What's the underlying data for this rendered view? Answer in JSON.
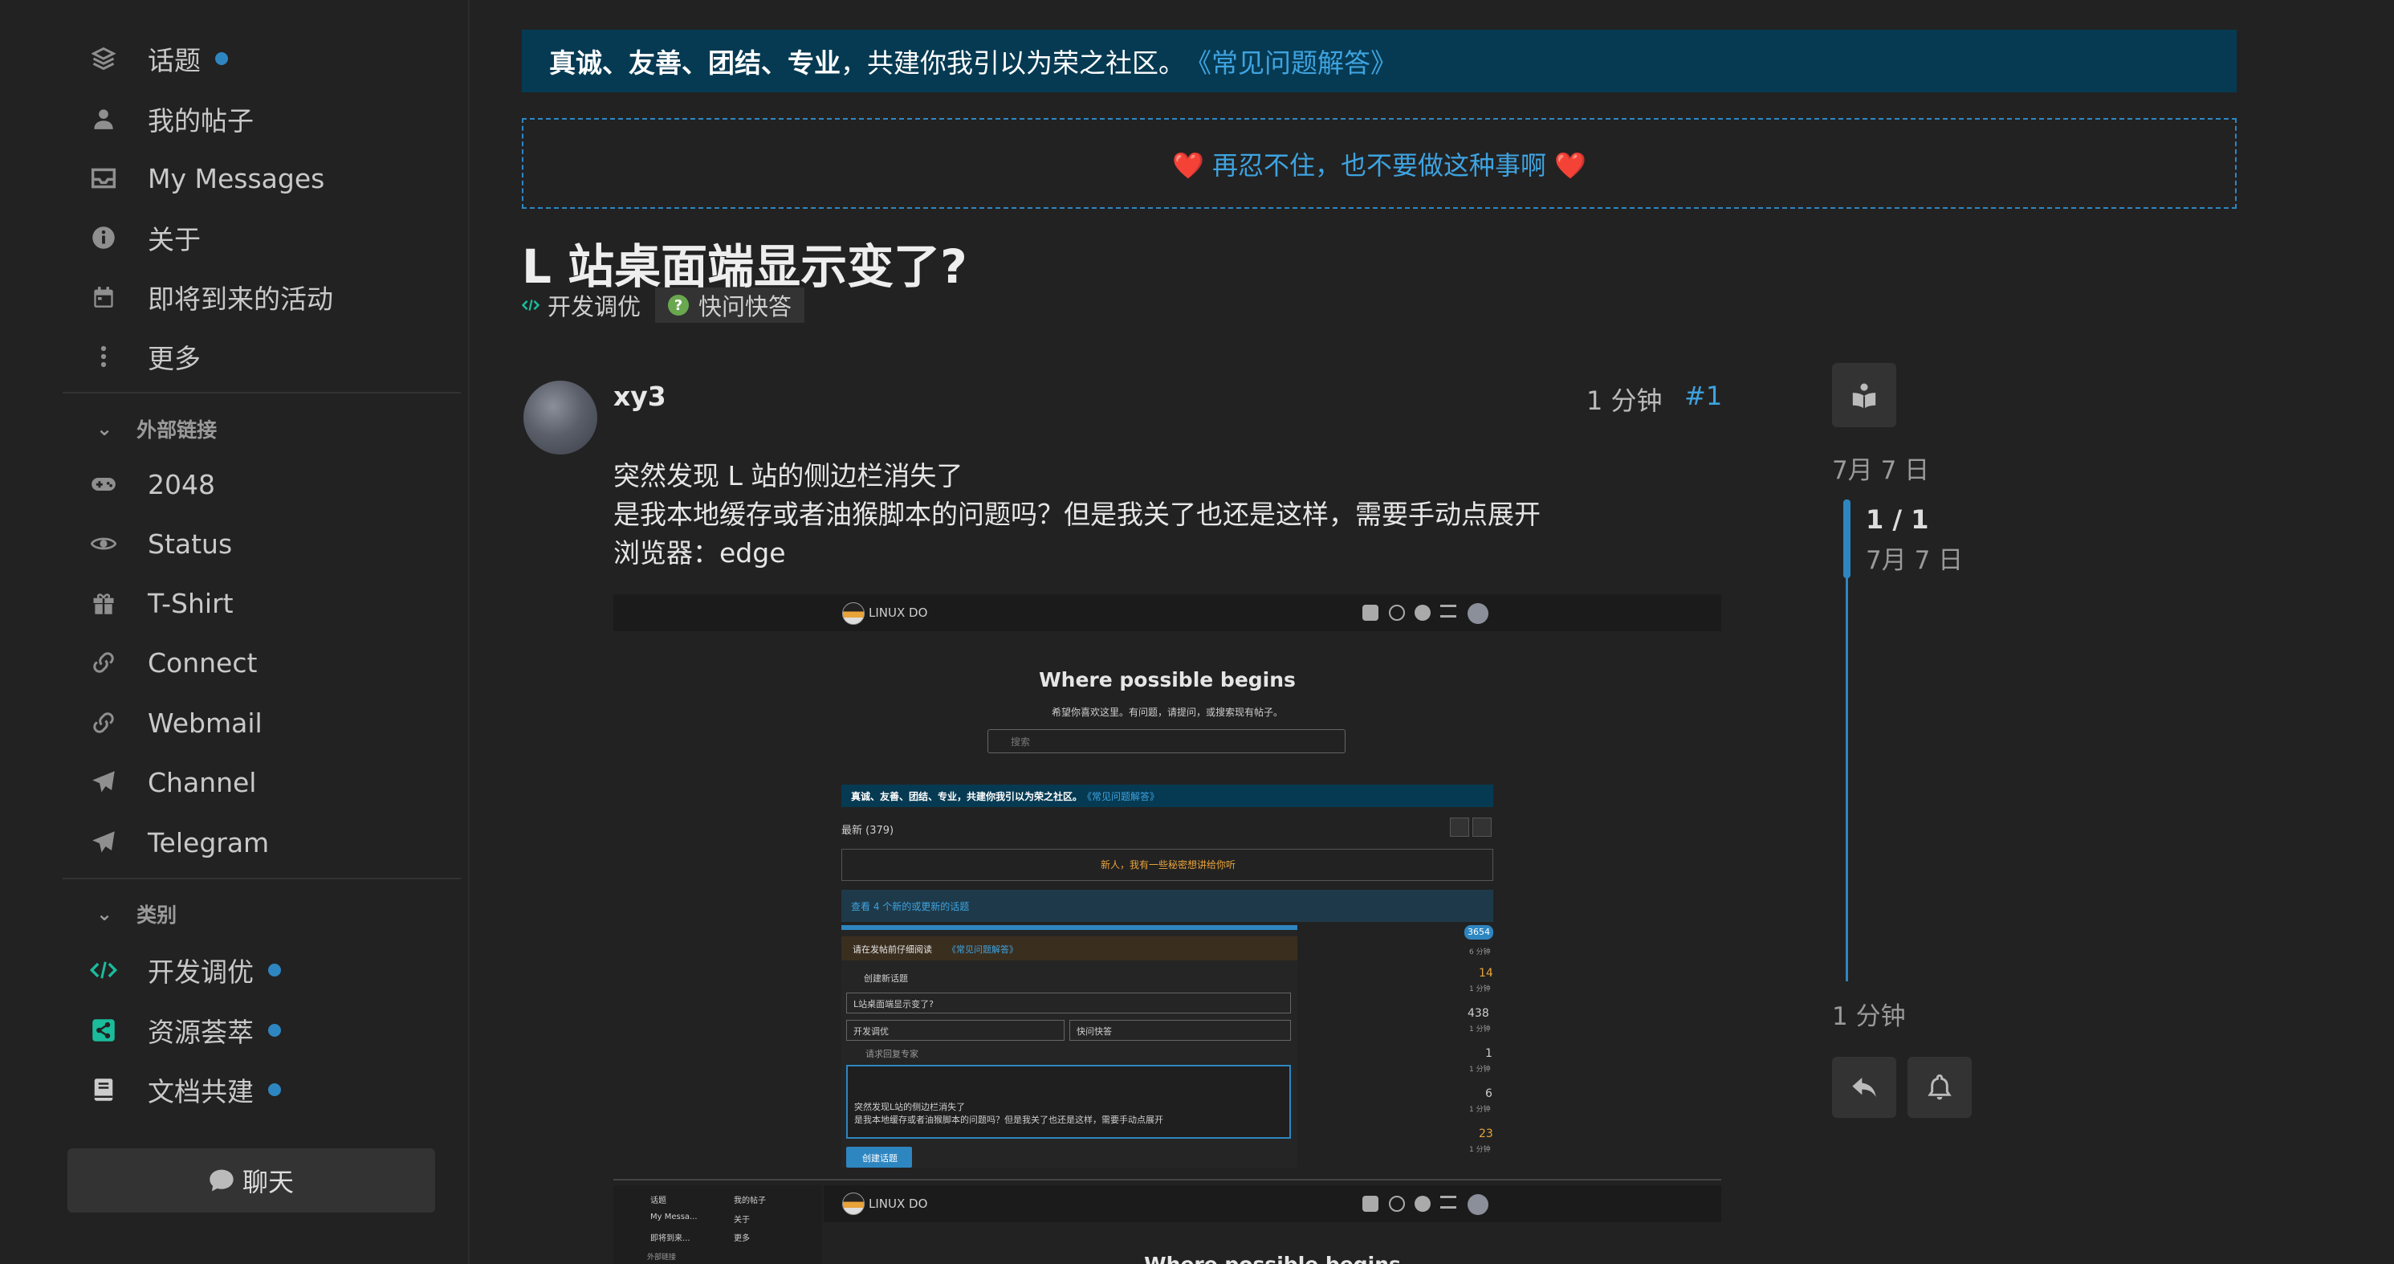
{
  "sidebar": {
    "items": [
      {
        "label": "话题",
        "icon": "layers-icon",
        "dot": true
      },
      {
        "label": "我的帖子",
        "icon": "user-icon",
        "dot": false
      },
      {
        "label": "My Messages",
        "icon": "inbox-icon",
        "dot": false
      },
      {
        "label": "关于",
        "icon": "info-icon",
        "dot": false
      },
      {
        "label": "即将到来的活动",
        "icon": "calendar-icon",
        "dot": false
      },
      {
        "label": "更多",
        "icon": "more-vertical-icon",
        "dot": false
      }
    ],
    "external_header": "外部链接",
    "external": [
      {
        "label": "2048",
        "icon": "gamepad-icon"
      },
      {
        "label": "Status",
        "icon": "eye-icon"
      },
      {
        "label": "T-Shirt",
        "icon": "gift-icon"
      },
      {
        "label": "Connect",
        "icon": "link-icon"
      },
      {
        "label": "Webmail",
        "icon": "link-icon"
      },
      {
        "label": "Channel",
        "icon": "paper-plane-icon"
      },
      {
        "label": "Telegram",
        "icon": "paper-plane-icon"
      }
    ],
    "categories_header": "类别",
    "categories": [
      {
        "label": "开发调优",
        "icon": "code-icon",
        "color": "#1abc9c"
      },
      {
        "label": "资源荟萃",
        "icon": "share-icon",
        "color": "#1abc9c"
      },
      {
        "label": "文档共建",
        "icon": "book-icon",
        "color": "#cccccc"
      }
    ],
    "chat_label": "聊天"
  },
  "banner": {
    "bold": "真诚、友善、团结、专业",
    "text": "，共建你我引以为荣之社区。",
    "link": "《常见问题解答》"
  },
  "notice": {
    "text": "❤️ 再忍不住，也不要做这种事啊 ❤️"
  },
  "topic": {
    "title": "L 站桌面端显示变了?",
    "category": "开发调优",
    "tag": "快问快答"
  },
  "post": {
    "username": "xy3",
    "time": "1 分钟",
    "number": "#1",
    "lines": [
      "突然发现 L 站的侧边栏消失了",
      "是我本地缓存或者油猴脚本的问题吗？但是我关了也还是这样，需要手动点展开",
      "浏览器：edge"
    ]
  },
  "screenshot": {
    "site_name": "LINUX DO",
    "hero_title": "Where possible begins",
    "hero_sub": "希望你喜欢这里。有问题，请提问，或搜索现有帖子。",
    "search_placeholder": "搜索",
    "banner_text": "真诚、友善、团结、专业，共建你我引以为荣之社区。",
    "banner_link": "《常见问题解答》",
    "latest_label": "最新 (379)",
    "newbie_text": "新人，我有一些秘密想讲给你听",
    "new_topics": "查看 4 个新的或更新的话题",
    "composer_hint": "请在发帖前仔细阅读",
    "composer_hint_link": "《常见问题解答》",
    "create_topic_label": "创建新话题",
    "composer_title": "L站桌面端显示变了?",
    "composer_category": "开发调优",
    "composer_tag": "快问快答",
    "expert_label": "请求回复专家",
    "body_lines": [
      "突然发现L站的侧边栏消失了",
      "是我本地缓存或者油猴脚本的问题吗？但是我关了也还是这样，需要手动点展开"
    ],
    "submit_label": "创建话题",
    "counts": [
      "3654",
      "14",
      "438",
      "1",
      "6",
      "23"
    ],
    "count_times": [
      "6 分钟",
      "1 分钟",
      "1 分钟",
      "1 分钟",
      "1 分钟",
      "1 分钟"
    ],
    "mini_sidebar": [
      "话题",
      "My Messa...",
      "即将到来..."
    ],
    "mini_sidebar2": [
      "我的帖子",
      "关于",
      "更多"
    ],
    "mini_ext": "外部链接",
    "hero_title_2": "Where possible begins"
  },
  "timeline": {
    "date_top": "7月 7 日",
    "position": "1 / 1",
    "date": "7月 7 日",
    "bottom": "1 分钟"
  },
  "colors": {
    "accent": "#2e86c1",
    "banner_bg": "#063a52",
    "link": "#3ea3e0"
  }
}
